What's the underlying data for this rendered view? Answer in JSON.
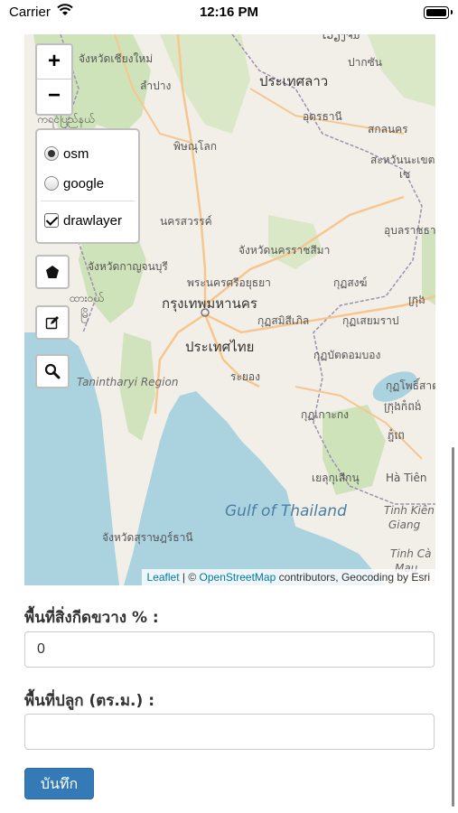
{
  "status_bar": {
    "carrier": "Carrier",
    "time": "12:16 PM"
  },
  "map": {
    "zoom_in": "+",
    "zoom_out": "−",
    "layers": [
      {
        "label": "osm",
        "type": "radio",
        "selected": true
      },
      {
        "label": "google",
        "type": "radio",
        "selected": false
      },
      {
        "label": "drawlayer",
        "type": "checkbox",
        "checked": true
      }
    ],
    "tools": [
      "polygon-icon",
      "edit-icon",
      "search-icon"
    ],
    "labels": {
      "chiang_mai": "จังหวัดเชียงใหม่",
      "lampang": "ลำปาง",
      "myanmar_top": "ကရင်ပြည်နယ်",
      "phitsanulok": "พิษณุโลก",
      "nakhon_sawan": "นครสวรรค์",
      "kanchanaburi": "จังหวัดกาญจนบุรี",
      "myanmar_side": "ထားဝယ်",
      "myanmar_side2": "မြိ",
      "ayutthaya": "พระนครศรีอยุธยา",
      "bangkok": "กรุงเทพมหานคร",
      "thailand": "ประเทศไทย",
      "rayong": "ระยอง",
      "tanintharyi": "Tanintharyi Region",
      "laos": "ประเทศลาว",
      "vientiane": "ເວຽງຈັນ",
      "pakxan": "ปากซัน",
      "udon": "อุดรธานี",
      "sakon": "สกลนคร",
      "savannakhet": "สะหวันนะเขต",
      "se": "เซ",
      "nakhon_ratchasima": "จังหวัดนครราชสีมา",
      "ubon": "อุบลราชธานี",
      "sangkhla": "กุฏสงฆ์",
      "prachinburi": "กุฏสมิสีเภิล",
      "siem": "กุฏเสยมราป",
      "krong": "ក្រុង",
      "battambang": "กุฏบัตดอมบอง",
      "pursat": "กุฏโพธิ์สาต",
      "kampong": "ក្រុងកំពង់",
      "koh_kong": "กุฏเกาะกง",
      "sihanouk": "เยลุกุเสีกนุ",
      "phnom": "ភ្នំពេ",
      "ha_tien": "Hà Tiên",
      "tinh_kien": "Tinh Kiên",
      "giang": "Giang",
      "tinh_ca": "Tinh Cà",
      "mau": "Mau",
      "chumphon": "จังหวัดสุราษฎร์ธานี",
      "gulf": "Gulf of Thailand"
    },
    "attribution": {
      "leaflet": "Leaflet",
      "sep": " | © ",
      "osm": "OpenStreetMap",
      "rest": " contributors, Geocoding by Esri"
    }
  },
  "form": {
    "obstruct_label": "พื้นที่สิ่งกีดขวาง % :",
    "obstruct_value": "0",
    "planted_label": "พื้นที่ปลูก (ตร.ม.) :",
    "planted_value": "",
    "save_label": "บันทึก"
  },
  "colors": {
    "land": "#f2efe9",
    "sea": "#aad3df",
    "forest": "#c8e0b0",
    "primary_button": "#337ab7",
    "road": "#f7c68f",
    "border": "#9e8fb0"
  }
}
